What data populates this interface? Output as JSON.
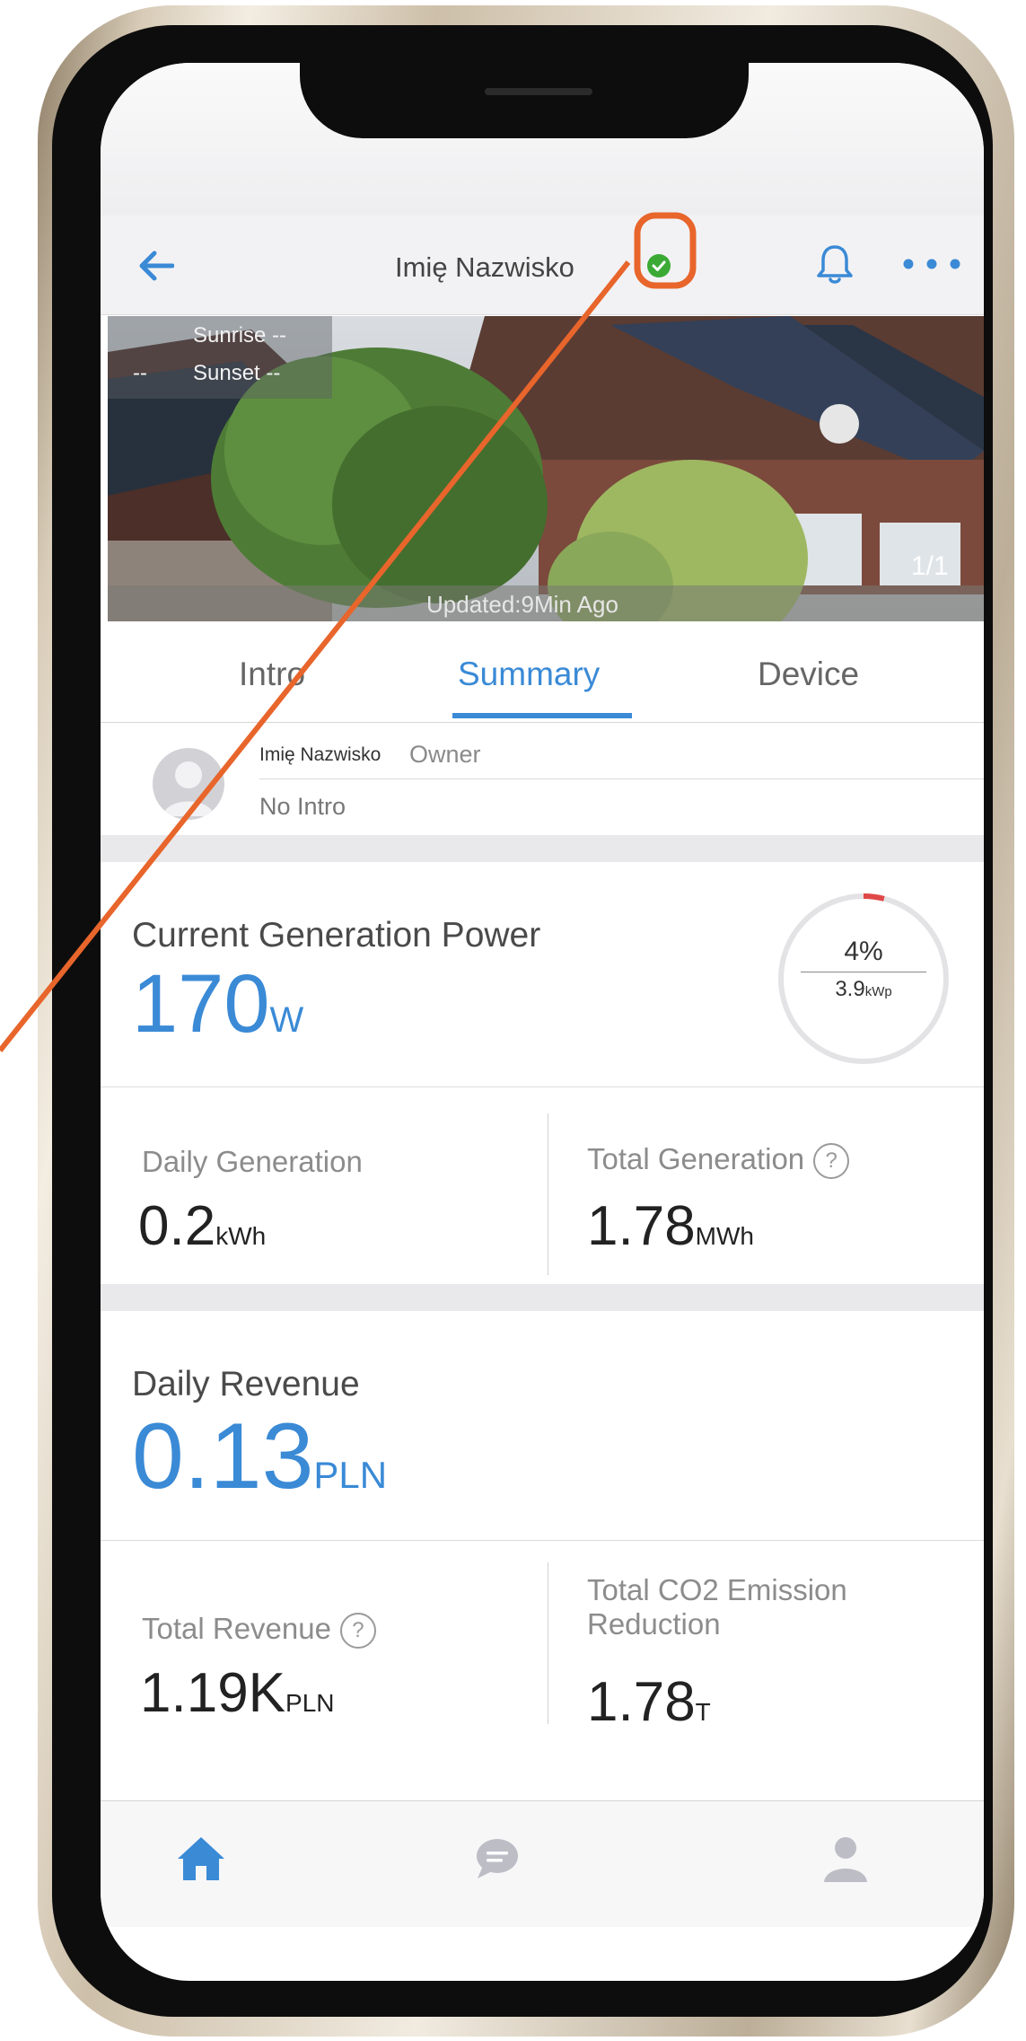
{
  "header": {
    "title": "Imię Nazwisko",
    "status_color": "#3aaa35",
    "highlight_color": "#e8652b"
  },
  "hero": {
    "sunrise": "Sunrise --",
    "sunset": "Sunset --",
    "left_dashes": "--",
    "updated": "Updated:9Min Ago",
    "page_indicator": "1/1"
  },
  "tabs": {
    "items": [
      "Intro",
      "Summary",
      "Device"
    ],
    "active": "Summary"
  },
  "owner": {
    "name": "Imię Nazwisko",
    "role": "Owner",
    "intro": "No Intro"
  },
  "generation": {
    "title": "Current Generation Power",
    "value": "170",
    "unit": "W",
    "gauge_percent_label": "4%",
    "gauge_percent": 4,
    "capacity": "3.9",
    "capacity_unit": "kWp",
    "daily_label": "Daily Generation",
    "daily_value": "0.2",
    "daily_unit": "kWh",
    "total_label": "Total Generation",
    "total_value": "1.78",
    "total_unit": "MWh",
    "help_glyph": "?"
  },
  "revenue": {
    "title": "Daily Revenue",
    "value": "0.13",
    "unit": "PLN",
    "total_label": "Total Revenue",
    "total_value": "1.19K",
    "total_unit": "PLN",
    "co2_label_1": "Total CO2 Emission",
    "co2_label_2": "Reduction",
    "co2_value": "1.78",
    "co2_unit": "T",
    "help_glyph": "?"
  },
  "tabbar": {
    "icons": [
      "home-icon",
      "message-icon",
      "profile-icon"
    ],
    "active_color": "#3a8ad6",
    "inactive_color": "#bdbdc6"
  }
}
